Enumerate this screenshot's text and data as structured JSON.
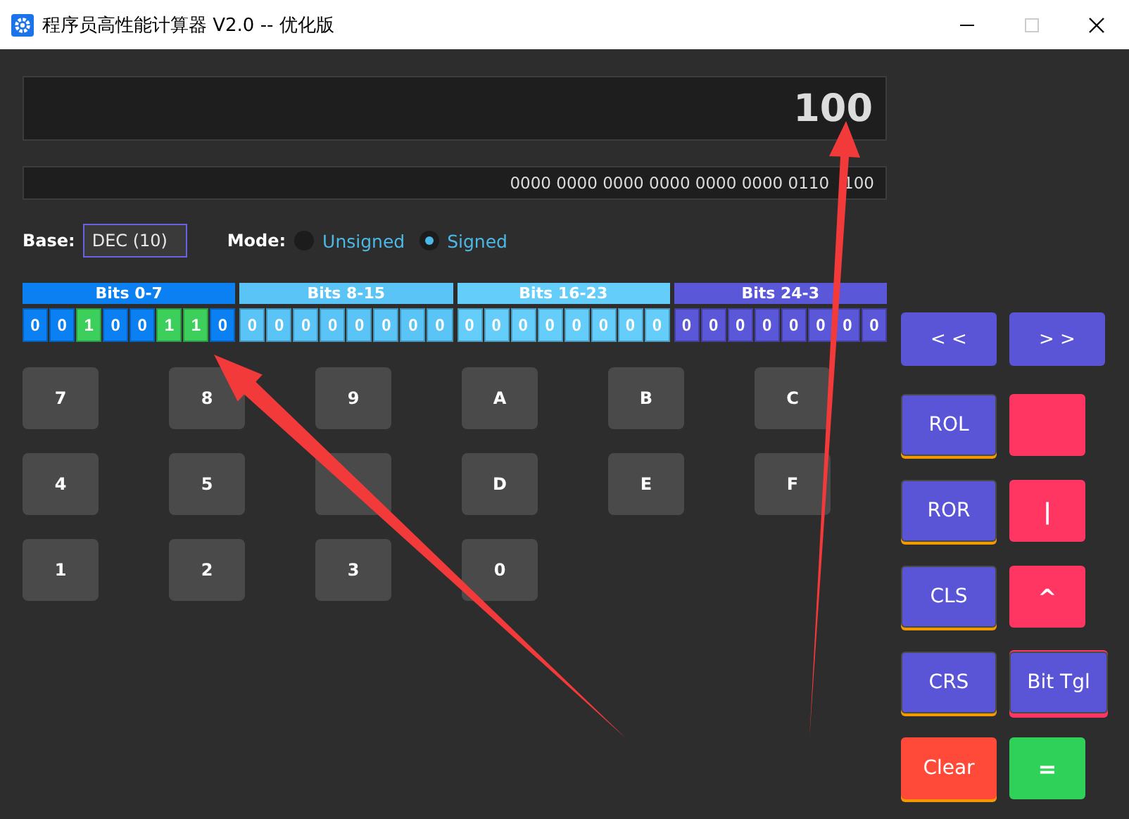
{
  "window": {
    "title": "程序员高性能计算器 V2.0 -- 优化版"
  },
  "display": {
    "value": "100",
    "binary": [
      "0000 0000 0000 0000 0000 0000 0110",
      "100"
    ]
  },
  "base": {
    "label": "Base:",
    "value": "DEC (10)"
  },
  "mode": {
    "label": "Mode:",
    "options": [
      {
        "label": "Unsigned",
        "selected": false
      },
      {
        "label": "Signed",
        "selected": true
      }
    ]
  },
  "bit_groups": [
    {
      "label": "Bits 0-7",
      "color": "#0a80f2",
      "bits": [
        {
          "value": "0",
          "set": false
        },
        {
          "value": "0",
          "set": false
        },
        {
          "value": "1",
          "set": true
        },
        {
          "value": "0",
          "set": false
        },
        {
          "value": "0",
          "set": false
        },
        {
          "value": "1",
          "set": true
        },
        {
          "value": "1",
          "set": true
        },
        {
          "value": "0",
          "set": false
        }
      ]
    },
    {
      "label": "Bits 8-15",
      "color": "#5ac4f6",
      "bits": [
        {
          "value": "0",
          "set": false
        },
        {
          "value": "0",
          "set": false
        },
        {
          "value": "0",
          "set": false
        },
        {
          "value": "0",
          "set": false
        },
        {
          "value": "0",
          "set": false
        },
        {
          "value": "0",
          "set": false
        },
        {
          "value": "0",
          "set": false
        },
        {
          "value": "0",
          "set": false
        }
      ]
    },
    {
      "label": "Bits 16-23",
      "color": "#64cdfa",
      "bits": [
        {
          "value": "0",
          "set": false
        },
        {
          "value": "0",
          "set": false
        },
        {
          "value": "0",
          "set": false
        },
        {
          "value": "0",
          "set": false
        },
        {
          "value": "0",
          "set": false
        },
        {
          "value": "0",
          "set": false
        },
        {
          "value": "0",
          "set": false
        },
        {
          "value": "0",
          "set": false
        }
      ]
    },
    {
      "label": "Bits 24-3",
      "color": "#5b57d9",
      "bits": [
        {
          "value": "0",
          "set": false
        },
        {
          "value": "0",
          "set": false
        },
        {
          "value": "0",
          "set": false
        },
        {
          "value": "0",
          "set": false
        },
        {
          "value": "0",
          "set": false
        },
        {
          "value": "0",
          "set": false
        },
        {
          "value": "0",
          "set": false
        },
        {
          "value": "0",
          "set": false
        }
      ]
    }
  ],
  "keypad": [
    {
      "kind": "key",
      "label": "7"
    },
    {
      "kind": "key",
      "label": "8"
    },
    {
      "kind": "key",
      "label": "9"
    },
    {
      "kind": "key",
      "label": "A"
    },
    {
      "kind": "key",
      "label": "B"
    },
    {
      "kind": "key",
      "label": "C"
    },
    {
      "kind": "key",
      "label": "4"
    },
    {
      "kind": "key",
      "label": "5"
    },
    {
      "kind": "key"
    },
    {
      "kind": "key",
      "label": "D"
    },
    {
      "kind": "key",
      "label": "E"
    },
    {
      "kind": "key",
      "label": "F"
    },
    {
      "kind": "key",
      "label": "1"
    },
    {
      "kind": "key",
      "label": "2"
    },
    {
      "kind": "key",
      "label": "3"
    },
    {
      "kind": "key",
      "label": "0"
    }
  ],
  "operators": [
    {
      "kind": "shift",
      "label": "< <"
    },
    {
      "kind": "shift",
      "label": "> >"
    },
    {
      "kind": "rotate",
      "label": "ROL"
    },
    {
      "kind": "logic"
    },
    {
      "kind": "rotate",
      "label": "ROR"
    },
    {
      "kind": "logic",
      "label": "|"
    },
    {
      "kind": "rotate",
      "label": "CLS"
    },
    {
      "kind": "logic",
      "label": "^"
    },
    {
      "kind": "rotate",
      "label": "CRS"
    },
    {
      "kind": "toggle",
      "label": "Bit Tgl"
    },
    {
      "kind": "clear",
      "label": "Clear"
    },
    {
      "kind": "equals",
      "label": "="
    }
  ]
}
